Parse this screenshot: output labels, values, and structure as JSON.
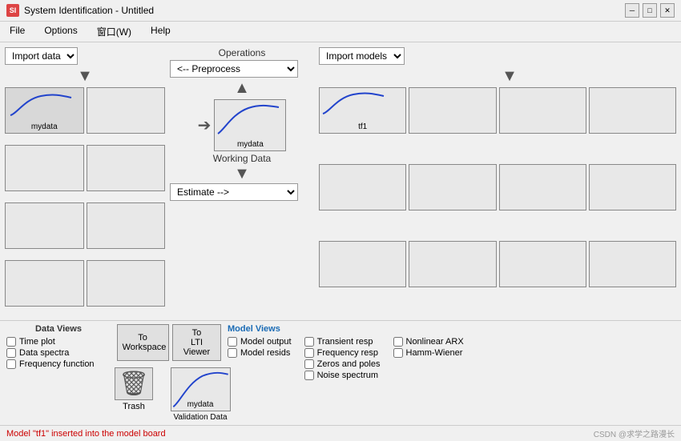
{
  "window": {
    "title": "System Identification - Untitled",
    "icon": "SI"
  },
  "menu": {
    "items": [
      "File",
      "Options",
      "窗口(W)",
      "Help"
    ]
  },
  "left_panel": {
    "import_label": "Import data",
    "cells": [
      {
        "id": 0,
        "has_data": true,
        "label": "mydata",
        "has_curve": true
      },
      {
        "id": 1,
        "has_data": false,
        "label": ""
      },
      {
        "id": 2,
        "has_data": false,
        "label": ""
      },
      {
        "id": 3,
        "has_data": false,
        "label": ""
      },
      {
        "id": 4,
        "has_data": false,
        "label": ""
      },
      {
        "id": 5,
        "has_data": false,
        "label": ""
      },
      {
        "id": 6,
        "has_data": false,
        "label": ""
      },
      {
        "id": 7,
        "has_data": false,
        "label": ""
      }
    ]
  },
  "middle_panel": {
    "ops_label": "Operations",
    "preprocess_label": "<-- Preprocess",
    "working_data_label": "Working Data",
    "working_data_name": "mydata",
    "estimate_label": "Estimate -->"
  },
  "right_panel": {
    "import_label": "Import models",
    "cells": [
      {
        "id": 0,
        "has_data": true,
        "label": "tf1",
        "has_curve": true
      },
      {
        "id": 1,
        "has_data": false,
        "label": ""
      },
      {
        "id": 2,
        "has_data": false,
        "label": ""
      },
      {
        "id": 3,
        "has_data": false,
        "label": ""
      },
      {
        "id": 4,
        "has_data": false,
        "label": ""
      },
      {
        "id": 5,
        "has_data": false,
        "label": ""
      },
      {
        "id": 6,
        "has_data": false,
        "label": ""
      },
      {
        "id": 7,
        "has_data": false,
        "label": ""
      },
      {
        "id": 8,
        "has_data": false,
        "label": ""
      },
      {
        "id": 9,
        "has_data": false,
        "label": ""
      },
      {
        "id": 10,
        "has_data": false,
        "label": ""
      },
      {
        "id": 11,
        "has_data": false,
        "label": ""
      }
    ]
  },
  "data_views": {
    "label": "Data Views",
    "items": [
      "Time plot",
      "Data spectra",
      "Frequency function"
    ]
  },
  "buttons": {
    "to_workspace": "To\nWorkspace",
    "to_lti": "To\nLTI Viewer"
  },
  "trash": {
    "label": "Trash"
  },
  "validation": {
    "label": "Validation Data",
    "name": "mydata"
  },
  "model_views": {
    "label": "Model Views",
    "col1": [
      "Model output",
      "Model resids"
    ],
    "col2": [
      "Transient resp",
      "Frequency resp",
      "Zeros and poles",
      "Noise spectrum"
    ],
    "col3": [
      "Nonlinear ARX",
      "Hamm-Wiener"
    ]
  },
  "status": {
    "message": "Model \"tf1\" inserted into the model board",
    "watermark": "CSDN @求学之路漫长"
  }
}
